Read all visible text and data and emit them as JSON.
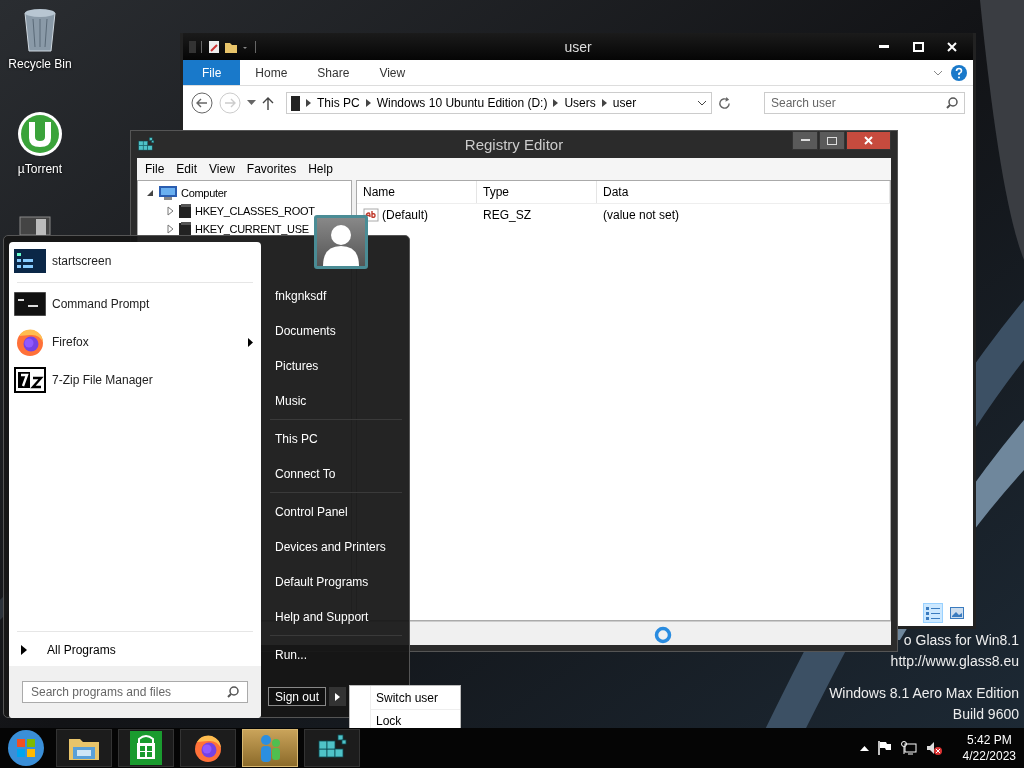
{
  "desktop_icons": [
    {
      "label": "Recycle Bin",
      "kind": "recycle"
    },
    {
      "label": "µTorrent",
      "kind": "torrent"
    }
  ],
  "desktop_text": [
    "o Glass for Win8.1",
    "http://www.glass8.eu",
    "Windows 8.1 Aero Max Edition",
    "Build 9600"
  ],
  "explorer": {
    "title": "user",
    "ribbon_tabs": [
      {
        "label": "File",
        "selected": true
      },
      {
        "label": "Home",
        "selected": false
      },
      {
        "label": "Share",
        "selected": false
      },
      {
        "label": "View",
        "selected": false
      }
    ],
    "breadcrumb": [
      "This PC",
      "Windows 10 Ubuntu Edition (D:)",
      "Users",
      "user"
    ],
    "search": {
      "placeholder": "Search user"
    },
    "view_buttons": [
      {
        "kind": "details",
        "selected": true
      },
      {
        "kind": "tiles",
        "selected": false
      }
    ]
  },
  "registry": {
    "title": "Registry Editor",
    "menu": [
      "File",
      "Edit",
      "View",
      "Favorites",
      "Help"
    ],
    "tree": {
      "label": "Computer",
      "expanded": true,
      "children": [
        {
          "label": "HKEY_CLASSES_ROOT",
          "expanded": false
        },
        {
          "label": "HKEY_CURRENT_USE",
          "expanded": false
        }
      ]
    },
    "columns": [
      "Name",
      "Type",
      "Data"
    ],
    "rows": [
      {
        "name": "(Default)",
        "type": "REG_SZ",
        "data": "(value not set)"
      }
    ]
  },
  "start_menu": {
    "pinned": [
      {
        "label": "startscreen",
        "kind": "startscreen",
        "has_submenu": false
      },
      {
        "label": "Command Prompt",
        "kind": "cmd",
        "has_submenu": false
      },
      {
        "label": "Firefox",
        "kind": "firefox",
        "has_submenu": true
      },
      {
        "label": "7-Zip File Manager",
        "kind": "zip",
        "has_submenu": false
      }
    ],
    "all_programs": "All Programs",
    "search": {
      "placeholder": "Search programs and files"
    },
    "places": [
      [
        "fnkgnksdf",
        "Documents",
        "Pictures",
        "Music"
      ],
      [
        "This PC",
        "Connect To"
      ],
      [
        "Control Panel",
        "Devices and Printers",
        "Default Programs",
        "Help and Support"
      ],
      [
        "Run..."
      ]
    ],
    "sign_out": "Sign out",
    "power_menu": [
      "Switch user",
      "Lock"
    ]
  },
  "taskbar": {
    "items": [
      {
        "kind": "explorer",
        "active": false
      },
      {
        "kind": "store",
        "active": false
      },
      {
        "kind": "firefox",
        "active": false
      },
      {
        "kind": "messenger",
        "active": true
      },
      {
        "kind": "registry",
        "active": false
      }
    ],
    "time": "5:42 PM",
    "date": "4/22/2023"
  }
}
